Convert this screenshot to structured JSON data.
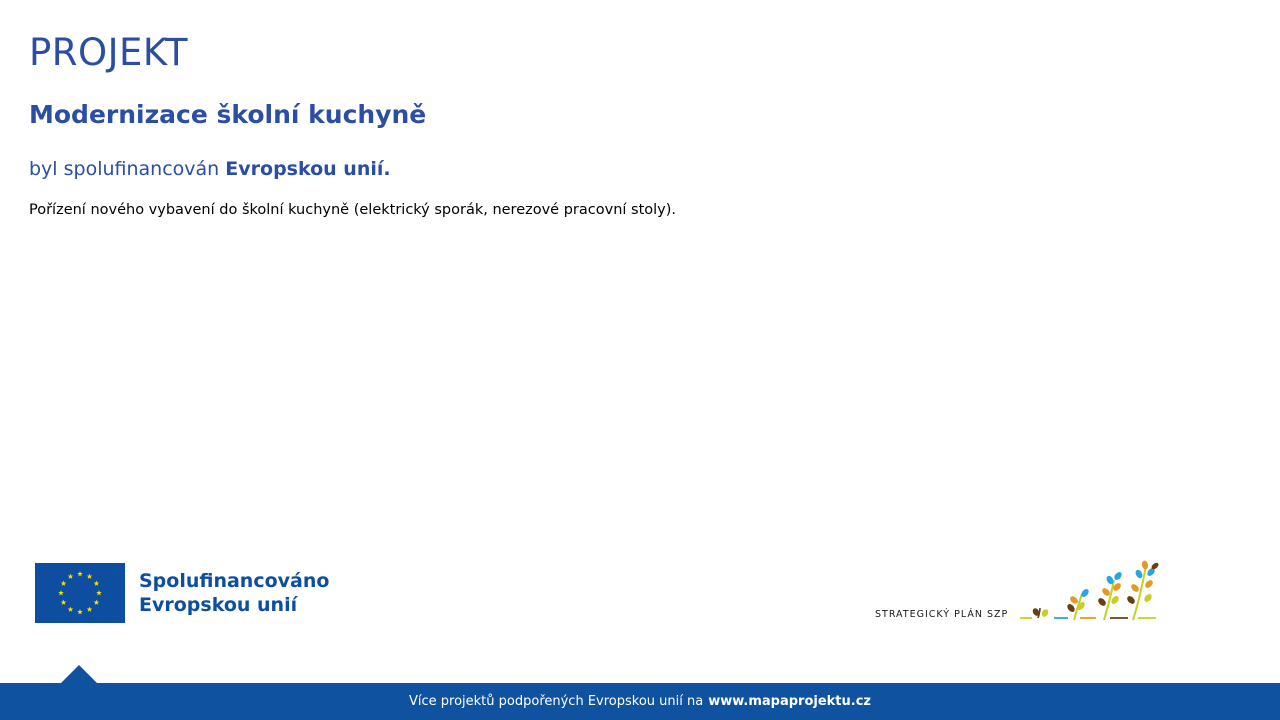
{
  "header": {
    "title": "PROJEKT",
    "project_name": "Modernizace školní kuchyně",
    "cofinanced_prefix": "byl spolufinancován",
    "cofinanced_bold": "Evropskou unií.",
    "description": "Pořízení nového vybavení do školní kuchyně (elektrický sporák, nerezové pracovní stoly)."
  },
  "eu_logo": {
    "line1": "Spolufinancováno",
    "line2": "Evropskou unií",
    "icon": "eu-flag-icon",
    "flag_color": "#0d4ea0",
    "star_color": "#ffdd00"
  },
  "szp_logo": {
    "text": "STRATEGICKÝ PLÁN SZP",
    "icon": "szp-plants-icon"
  },
  "footer": {
    "prefix": "Více projektů podpořených Evropskou unií na",
    "link": "www.mapaprojektu.cz",
    "color": "#0f52a0"
  },
  "colors": {
    "accent": "#2a4ea3"
  }
}
